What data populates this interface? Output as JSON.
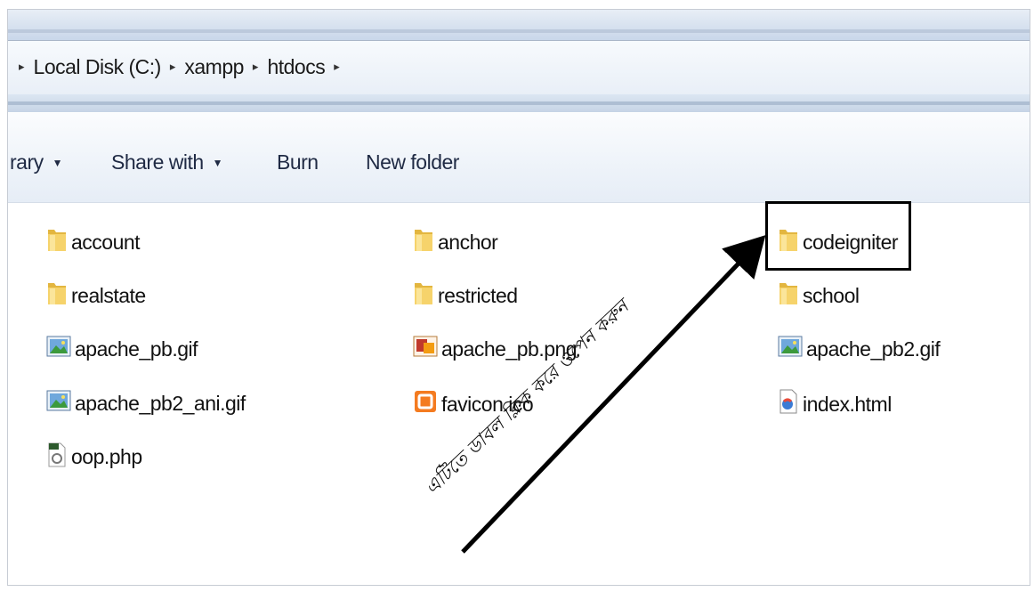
{
  "breadcrumb": [
    "Local Disk (C:)",
    "xampp",
    "htdocs"
  ],
  "breadcrumb_separator": "▸",
  "toolbar": {
    "library_label": "rary",
    "share_label": "Share with",
    "burn_label": "Burn",
    "new_folder_label": "New folder",
    "caret": "▼"
  },
  "files": [
    {
      "name": "account",
      "type": "folder"
    },
    {
      "name": "anchor",
      "type": "folder"
    },
    {
      "name": "codeigniter",
      "type": "folder"
    },
    {
      "name": "realstate",
      "type": "folder"
    },
    {
      "name": "restricted",
      "type": "folder"
    },
    {
      "name": "school",
      "type": "folder"
    },
    {
      "name": "apache_pb.gif",
      "type": "gif"
    },
    {
      "name": "apache_pb.png",
      "type": "png"
    },
    {
      "name": "apache_pb2.gif",
      "type": "gif"
    },
    {
      "name": "apache_pb2_ani.gif",
      "type": "gif"
    },
    {
      "name": "favicon.ico",
      "type": "ico"
    },
    {
      "name": "index.html",
      "type": "html"
    },
    {
      "name": "oop.php",
      "type": "php"
    }
  ],
  "annotation": {
    "text": "এটিতে ডাবল ক্লিক করে ওপেন করুন",
    "highlighted_item": "codeigniter"
  }
}
